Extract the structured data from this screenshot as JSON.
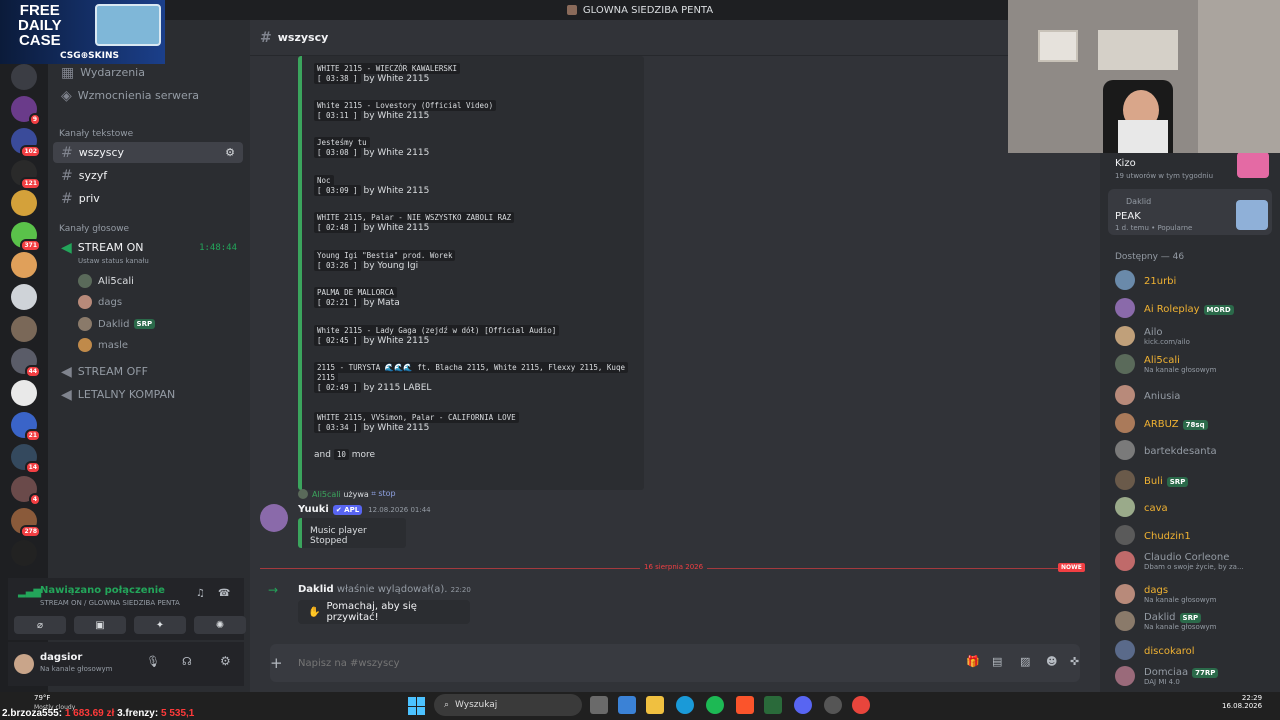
{
  "window": {
    "title": "GLOWNA SIEDZIBA PENTA"
  },
  "promo": {
    "line1": "FREE",
    "line2": "DAILY",
    "line3": "CASE",
    "brand": "CSG⊕SKINS"
  },
  "server": {
    "name_fragment": "ENTA"
  },
  "channels": {
    "top": [
      "Wydarzenia",
      "Wzmocnienia serwera"
    ],
    "text_category": "Kanały tekstowe",
    "text": [
      "wszyscy",
      "syzyf",
      "priv"
    ],
    "voice_category": "Kanały głosowe",
    "stream_on": "STREAM ON",
    "stream_timer": "1:48:44",
    "status_hint": "Ustaw status kanału",
    "voice_users": [
      {
        "name": "Ali5cali"
      },
      {
        "name": "dags"
      },
      {
        "name": "Daklid",
        "tag": "SRP"
      },
      {
        "name": "masle"
      }
    ],
    "stream_off": "STREAM OFF",
    "letalny": "LETALNY KOMPAN"
  },
  "voice_panel": {
    "status": "Nawiązano połączenie",
    "location": "STREAM ON / GLOWNA SIEDZIBA PENTA"
  },
  "user_panel": {
    "name": "dagsior",
    "status": "Na kanale głosowym"
  },
  "channel_header": {
    "name": "wszyscy"
  },
  "tracks": [
    {
      "title": "WHITE 2115 - WIECZÓR KAWALERSKI",
      "time": "03:38",
      "by": "White 2115"
    },
    {
      "title": "White 2115 - Lovestory (Official Video)",
      "time": "03:11",
      "by": "White 2115"
    },
    {
      "title": "Jesteśmy tu",
      "time": "03:08",
      "by": "White 2115"
    },
    {
      "title": "Noc",
      "time": "03:09",
      "by": "White 2115"
    },
    {
      "title": "WHITE 2115, Palar - NIE WSZYSTKO ZABOLI RAZ",
      "time": "02:48",
      "by": "White 2115"
    },
    {
      "title": "Young Igi \"Bestia\" prod. Worek",
      "time": "03:26",
      "by": "Young Igi"
    },
    {
      "title": "PALMA DE MALLORCA",
      "time": "02:21",
      "by": "Mata"
    },
    {
      "title": "White 2115 - Lady Gaga (zejdź w dół) [Official Audio]",
      "time": "02:45",
      "by": "White 2115"
    },
    {
      "title": "2115 - TURYSTA 🌊🌊🌊 ft. Blacha 2115, White 2115, Flexxy 2115, Kuqe",
      "title2": "2115",
      "time": "02:49",
      "by": "2115 LABEL"
    },
    {
      "title": "WHITE 2115, VVSimon, Palar - CALIFORNIA LOVE",
      "time": "03:34",
      "by": "White 2115"
    }
  ],
  "more": {
    "pre": "and",
    "count": "10",
    "post": "more"
  },
  "reply": {
    "user": "Ali5cali",
    "verb": "używa",
    "cmd": "⌗ stop"
  },
  "bot_msg": {
    "name": "Yuuki",
    "tag": "✔ APL",
    "time": "12.08.2026 01:44",
    "text": "Music player Stopped"
  },
  "divider": {
    "date": "16 sierpnia 2026",
    "new": "NOWE"
  },
  "join_msg": {
    "name": "Daklid",
    "text": "właśnie wylądował(a).",
    "time": "22:20",
    "wave": "Pomachaj, aby się przywitać!"
  },
  "input": {
    "placeholder": "Napisz na #wszyscy"
  },
  "activity": [
    {
      "title": "Kizo",
      "sub": "19 utworów w tym tygodniu"
    },
    {
      "user": "Daklid",
      "title": "PEAK",
      "sub": "1 d. temu • Popularne"
    }
  ],
  "members_header": "Dostępny — 46",
  "members": [
    {
      "name": "21urbi",
      "color": "#f0b232"
    },
    {
      "name": "Ai Roleplay",
      "tag": "MORD",
      "color": "#f0b232"
    },
    {
      "name": "Ailo",
      "sub": "kick.com/ailo",
      "color": "#949ba4"
    },
    {
      "name": "Ali5cali",
      "sub": "Na kanale głosowym",
      "color": "#f0b232"
    },
    {
      "name": "Aniusia",
      "color": "#949ba4"
    },
    {
      "name": "ARBUZ",
      "tag": "78sq",
      "color": "#f0b232"
    },
    {
      "name": "bartekdesanta",
      "color": "#949ba4"
    },
    {
      "name": "Buli",
      "tag": "SRP",
      "color": "#f0b232"
    },
    {
      "name": "cava",
      "color": "#f0b232"
    },
    {
      "name": "Chudzin1",
      "color": "#f0b232"
    },
    {
      "name": "Claudio Corleone",
      "sub": "Dbam o swoje życie, by za...",
      "color": "#949ba4"
    },
    {
      "name": "dags",
      "sub": "Na kanale głosowym",
      "color": "#f0b232"
    },
    {
      "name": "Daklid",
      "tag": "SRP",
      "sub": "Na kanale głosowym",
      "color": "#949ba4"
    },
    {
      "name": "discokarol",
      "color": "#f0b232"
    },
    {
      "name": "Domciaa",
      "tag": "77RP",
      "sub": "DAJ MI 4.0",
      "color": "#949ba4"
    }
  ],
  "taskbar": {
    "weather_temp": "79°F",
    "weather_desc": "Mostly cloudy",
    "search": "Wyszukaj",
    "time": "22:29",
    "date": "16.08.2026"
  },
  "ticker": {
    "a_name": "2.brzoza555:",
    "a_val": "1 683.69 zł",
    "b_name": "3.frenzy:",
    "b_val": "5 535,1"
  }
}
